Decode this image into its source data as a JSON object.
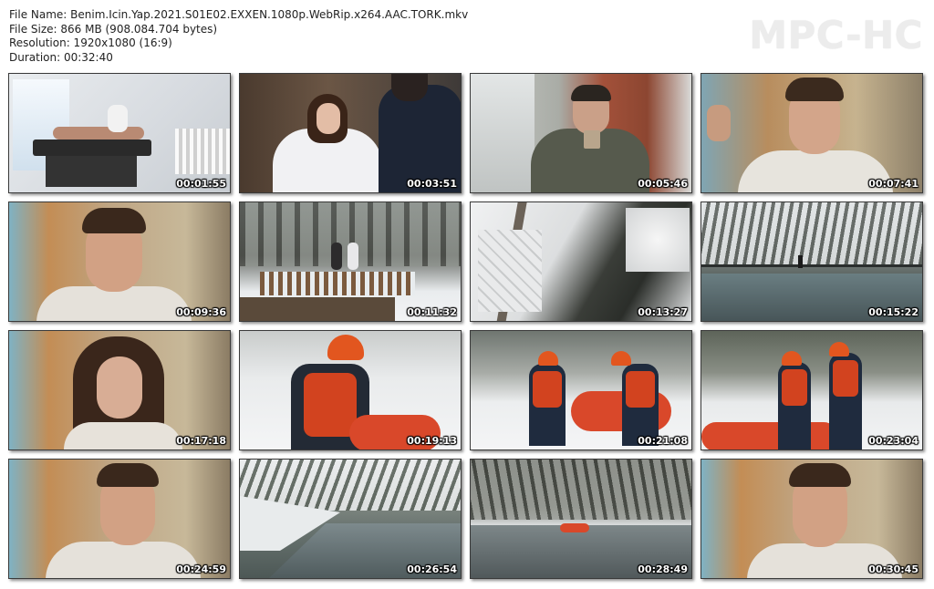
{
  "file_info": {
    "file_name": "File Name: Benim.Icin.Yap.2021.S01E02.EXXEN.1080p.WebRip.x264.AAC.TORK.mkv",
    "file_size": "File Size: 866 MB (908.084.704 bytes)",
    "resolution": "Resolution: 1920x1080 (16:9)",
    "duration": "Duration: 00:32:40"
  },
  "logo": "MPC-HC",
  "thumbnails": [
    {
      "timestamp": "00:01:55",
      "scene": "massage-room"
    },
    {
      "timestamp": "00:03:51",
      "scene": "couple-outdoors"
    },
    {
      "timestamp": "00:05:46",
      "scene": "man-drinking"
    },
    {
      "timestamp": "00:07:41",
      "scene": "man-talking"
    },
    {
      "timestamp": "00:09:36",
      "scene": "man-closeup"
    },
    {
      "timestamp": "00:11:32",
      "scene": "snowy-garden"
    },
    {
      "timestamp": "00:13:27",
      "scene": "aerial-snow"
    },
    {
      "timestamp": "00:15:22",
      "scene": "snowy-river"
    },
    {
      "timestamp": "00:17:18",
      "scene": "woman-closeup"
    },
    {
      "timestamp": "00:19:13",
      "scene": "rafting-woman"
    },
    {
      "timestamp": "00:21:08",
      "scene": "rafting-pair"
    },
    {
      "timestamp": "00:23:04",
      "scene": "rafting-pair-wide"
    },
    {
      "timestamp": "00:24:59",
      "scene": "man-closeup-2"
    },
    {
      "timestamp": "00:26:54",
      "scene": "river-valley"
    },
    {
      "timestamp": "00:28:49",
      "scene": "river-raft"
    },
    {
      "timestamp": "00:30:45",
      "scene": "man-closeup-3"
    }
  ],
  "colors": {
    "thumb_border": "#3a3a3a",
    "logo": "#ececec"
  }
}
